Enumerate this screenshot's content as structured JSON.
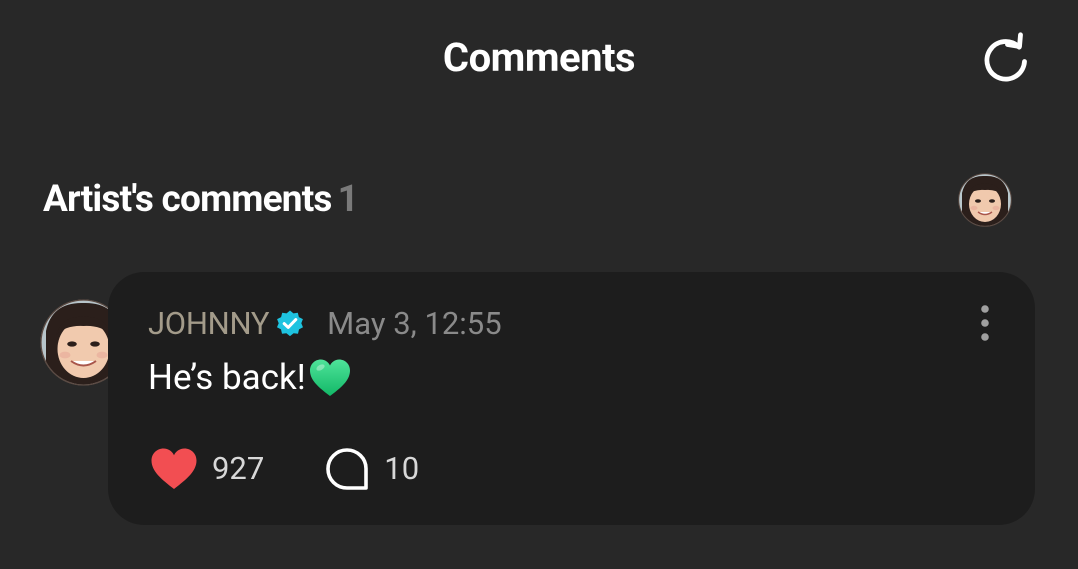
{
  "header": {
    "title": "Comments",
    "refresh_icon": "refresh-icon"
  },
  "section": {
    "title": "Artist's comments",
    "count": "1",
    "filter_avatar_icon": "artist-avatar"
  },
  "comment": {
    "author": "JOHNNY",
    "verified_icon": "verified-badge-icon",
    "date": "May 3, 12:55",
    "text": "He’s back!",
    "emoji": "green-heart-emoji",
    "likes": "927",
    "replies": "10",
    "more_icon": "more-vertical-icon"
  },
  "colors": {
    "background": "#282828",
    "card": "#1d1d1d",
    "author": "#a39b8a",
    "date": "#8a8a8a",
    "count": "#7a7a7a",
    "like": "#f24e52",
    "verified": "#1ec3e0",
    "green_heart": "#2ed47a"
  }
}
